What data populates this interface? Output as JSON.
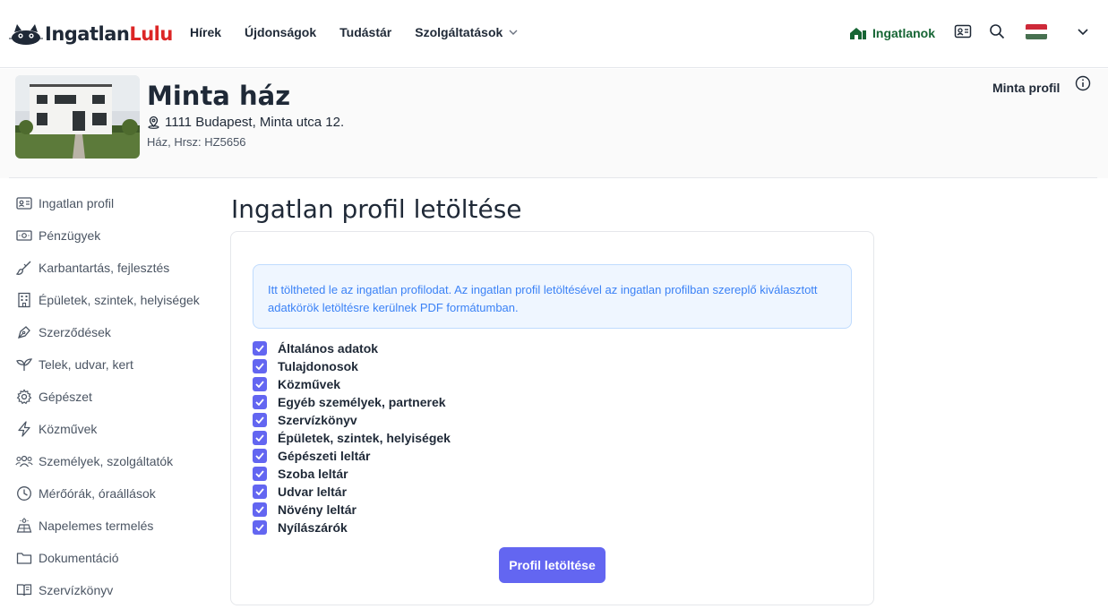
{
  "brand": {
    "name_part1": "Ingatlan",
    "name_part2": "Lulu"
  },
  "nav": {
    "items": [
      {
        "label": "Hírek"
      },
      {
        "label": "Újdonságok"
      },
      {
        "label": "Tudástár"
      },
      {
        "label": "Szolgáltatások"
      }
    ]
  },
  "header_tools": {
    "properties_label": "Ingatlanok",
    "language_flag": "hungarian-flag"
  },
  "property": {
    "title": "Minta ház",
    "address": "1111 Budapest, Minta utca 12.",
    "meta": "Ház, Hrsz: HZ5656",
    "profile_label": "Minta profil"
  },
  "sidebar": {
    "items": [
      {
        "label": "Ingatlan profil",
        "icon": "id-card-icon"
      },
      {
        "label": "Pénzügyek",
        "icon": "banknote-icon"
      },
      {
        "label": "Karbantartás, fejlesztés",
        "icon": "brush-icon"
      },
      {
        "label": "Épületek, szintek, helyiségek",
        "icon": "building-icon"
      },
      {
        "label": "Szerződések",
        "icon": "pen-nib-icon"
      },
      {
        "label": "Telek, udvar, kert",
        "icon": "sprout-icon"
      },
      {
        "label": "Gépészet",
        "icon": "gear-icon"
      },
      {
        "label": "Közművek",
        "icon": "bolt-icon"
      },
      {
        "label": "Személyek, szolgáltatók",
        "icon": "users-icon"
      },
      {
        "label": "Mérőórák, óraállások",
        "icon": "clock-icon"
      },
      {
        "label": "Napelemes termelés",
        "icon": "solar-panel-icon"
      },
      {
        "label": "Dokumentáció",
        "icon": "folder-icon"
      },
      {
        "label": "Szervízkönyv",
        "icon": "book-icon"
      }
    ]
  },
  "main": {
    "title": "Ingatlan profil letöltése",
    "alert": "Itt töltheted le az ingatlan profilodat. Az ingatlan profil letöltésével az ingatlan profilban szereplő kiválasztott adatkörök letöltésre kerülnek PDF formátumban.",
    "checkboxes": [
      {
        "label": "Általános adatok",
        "checked": true
      },
      {
        "label": "Tulajdonosok",
        "checked": true
      },
      {
        "label": "Közművek",
        "checked": true
      },
      {
        "label": "Egyéb személyek, partnerek",
        "checked": true
      },
      {
        "label": "Szervízkönyv",
        "checked": true
      },
      {
        "label": "Épületek, szintek, helyiségek",
        "checked": true
      },
      {
        "label": "Gépészeti leltár",
        "checked": true
      },
      {
        "label": "Szoba leltár",
        "checked": true
      },
      {
        "label": "Udvar leltár",
        "checked": true
      },
      {
        "label": "Növény leltár",
        "checked": true
      },
      {
        "label": "Nyílászárók",
        "checked": true
      }
    ],
    "download_button": "Profil letöltése"
  },
  "colors": {
    "accent": "#6366f1",
    "brand_red": "#dc2626",
    "properties_green": "#166534",
    "alert_text": "#3b82f6"
  }
}
